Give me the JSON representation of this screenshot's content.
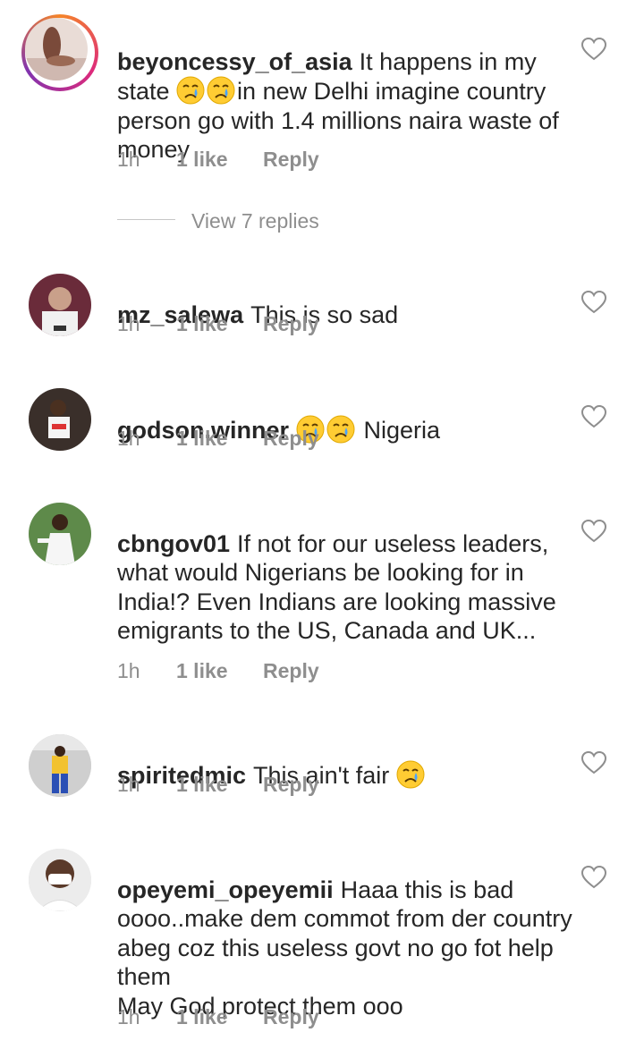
{
  "comments": [
    {
      "username": "beyoncessy_of_asia",
      "text_parts": [
        "It happens in my state ",
        "in new Delhi imagine country person go with 1.4 millions naira waste of money"
      ],
      "emoji": "crying-face",
      "time": "1h",
      "likes": "1 like",
      "reply": "Reply",
      "has_story_ring": true
    },
    {
      "username": "mz_salewa",
      "text": "This is so sad",
      "time": "1h",
      "likes": "1 like",
      "reply": "Reply"
    },
    {
      "username": "godson.winner",
      "text": "Nigeria",
      "emoji": "crying-face",
      "time": "1h",
      "likes": "1 like",
      "reply": "Reply"
    },
    {
      "username": "cbngov01",
      "text": "If not for our useless leaders, what would Nigerians be looking for in India!? Even Indians are looking massive emigrants to the US, Canada and UK...",
      "time": "1h",
      "likes": "1 like",
      "reply": "Reply"
    },
    {
      "username": "spiritedmic",
      "text": "This ain't fair",
      "emoji": "crying-face",
      "time": "1h",
      "likes": "1 like",
      "reply": "Reply"
    },
    {
      "username": "opeyemi_opeyemii",
      "text": "Haaa this is bad oooo..make dem commot from der country abeg coz this useless govt no go fot help them\nMay God protect them ooo",
      "time": "1h",
      "likes": "1 like",
      "reply": "Reply"
    }
  ],
  "view_replies": "View 7 replies",
  "colors": {
    "text": "#262626",
    "meta": "#8e8e8e",
    "divider": "#c7c7c7",
    "story_ring": [
      "#f58529",
      "#dd2a7b",
      "#8134af"
    ]
  },
  "icons": {
    "like": "heart-outline-icon",
    "emoji": "crying-face"
  }
}
